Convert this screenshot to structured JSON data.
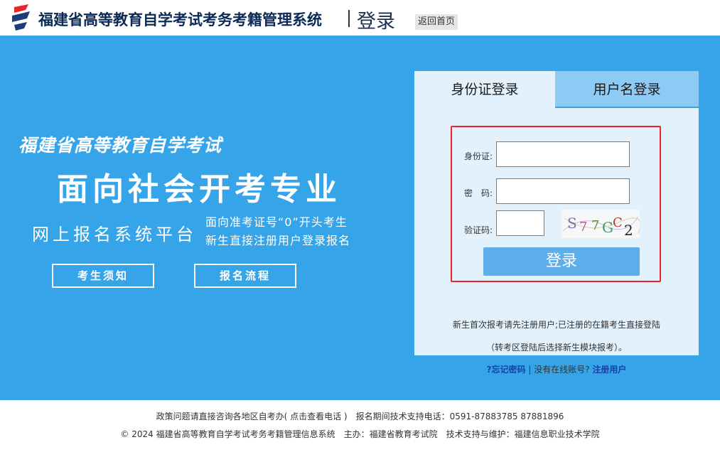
{
  "header": {
    "system_title": "福建省高等教育自学考试考务考籍管理系统",
    "page_title": "登录",
    "back_home": "返回首页"
  },
  "banner": {
    "slogan_top": "福建省高等教育自学考试",
    "slogan_main": "面向社会开考专业",
    "slogan_sub": "网上报名系统平台",
    "side_line1": "面向准考证号“0”开头考生",
    "side_line2": "新生直接注册用户登录报名",
    "btn_notice": "考生须知",
    "btn_flow": "报名流程",
    "background_color": "#35a4e9"
  },
  "login": {
    "tab_id": "身份证登录",
    "tab_user": "用户名登录",
    "label_id": "身份证:",
    "label_password": "密　码:",
    "label_captcha": "验证码:",
    "captcha_text": "S7 7G2",
    "submit": "登录",
    "note_line1": "新生首次报考请先注册用户;已注册的在籍考生直接登陆",
    "note_line2": "（转考区登陆后选择新生模块报考）。",
    "forgot_password": "?忘记密码",
    "separator": "|",
    "no_account": "没有在线账号?",
    "register": "注册用户",
    "highlight_color": "#e8262a"
  },
  "footer": {
    "line1": "政策问题请直接咨询各地区自考办( 点击查看电话 )　报名期间技术支持电话：0591-87883785 87881896",
    "line2": "© 2024 福建省高等教育自学考试考务考籍管理信息系统　主办：福建省教育考试院　技术支持与维护：福建信息职业技术学院"
  }
}
